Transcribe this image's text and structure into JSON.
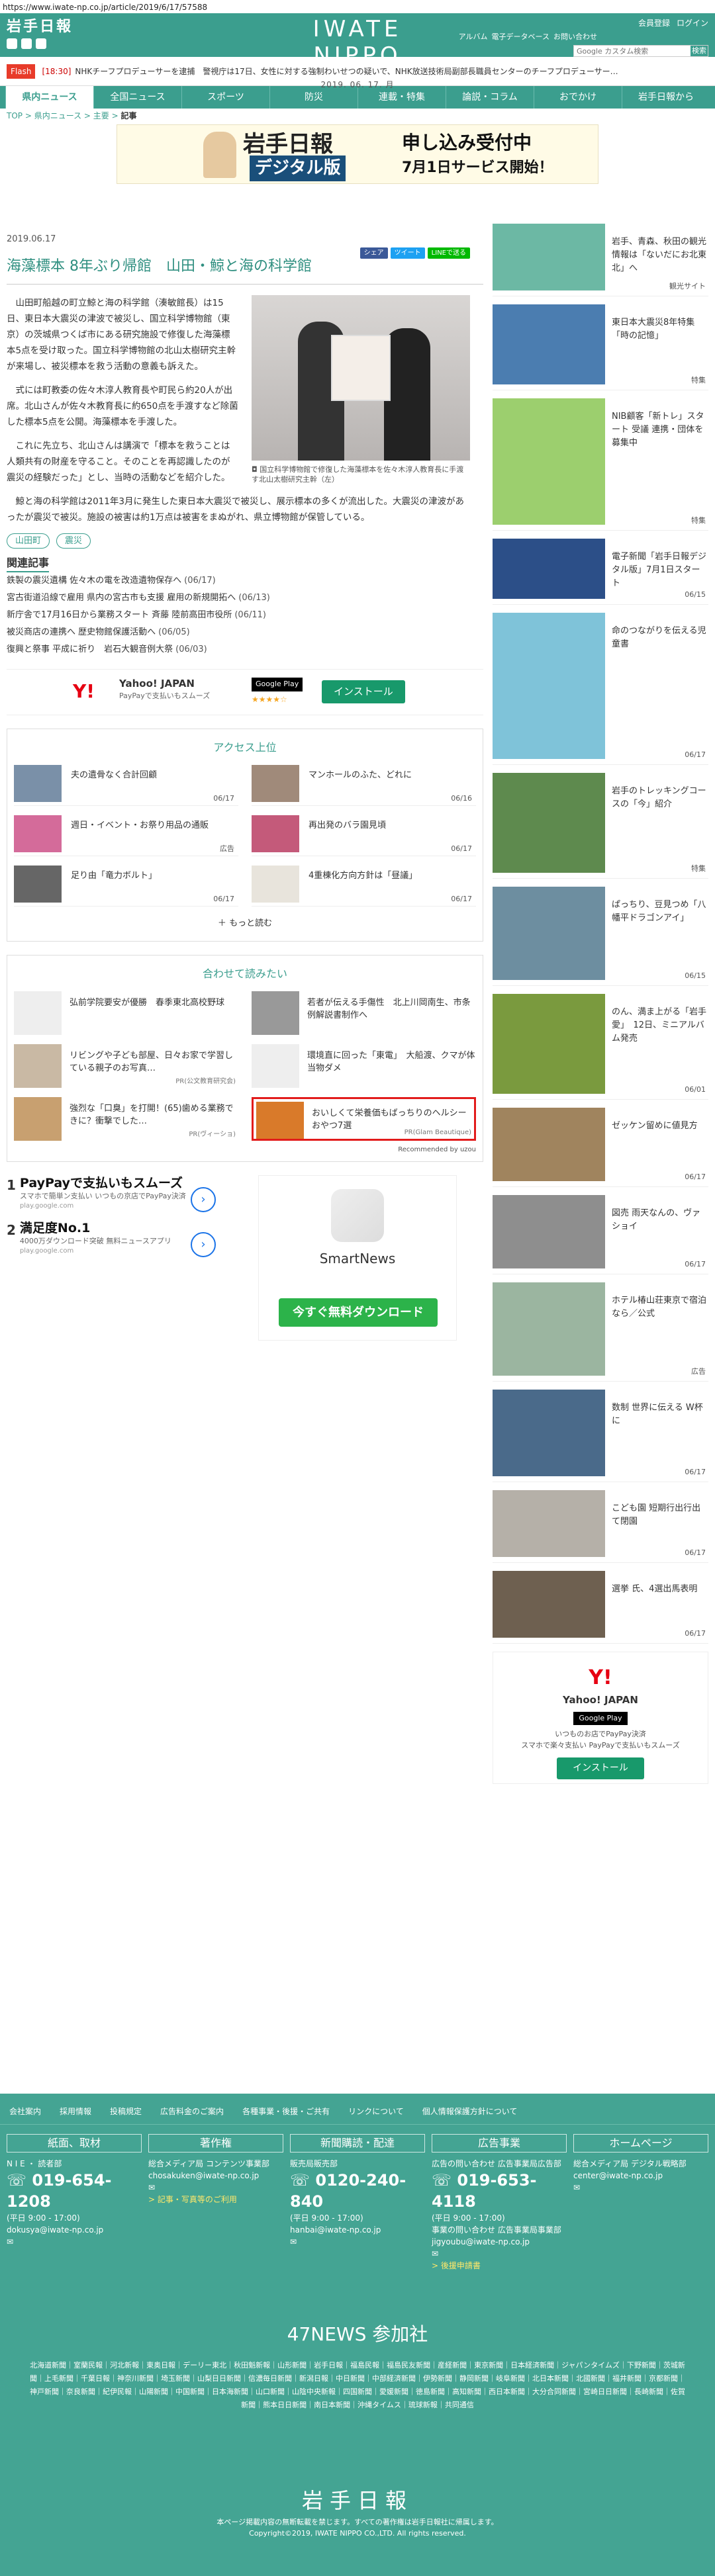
{
  "url": "https://www.iwate-np.co.jp/article/2019/6/17/57588",
  "header": {
    "logo": "岩手日報",
    "brand": "IWATE NIPPO",
    "date": "2019. 06. 17.  月",
    "links": [
      "会員登録",
      "ログイン"
    ],
    "sub": [
      "Web",
      "アルバム",
      "→",
      "電子データベース",
      "→",
      "お問い合わせ"
    ],
    "search_placeholder": "Google カスタム検索",
    "search_btn": "検索"
  },
  "flash": {
    "tag": "Flash",
    "time": "[18:30]",
    "message": "NHKチーフプロデューサーを逮捕　警視庁は17日、女性に対する強制わいせつの疑いで、NHK放送技術局副部長職員センターのチーフプロデューサー…"
  },
  "nav": [
    "県内ニュース",
    "全国ニュース",
    "スポーツ",
    "防災",
    "連載・特集",
    "論説・コラム",
    "おでかけ",
    "岩手日報から"
  ],
  "breadcrumb": [
    "TOP",
    "県内ニュース",
    "主要",
    "記事"
  ],
  "banner": {
    "logo": "岩手日報",
    "sub": "デジタル版",
    "headline": "申し込み受付中",
    "line2": "7月1日サービス開始！"
  },
  "article": {
    "date": "2019.06.17",
    "share": [
      "シェア",
      "ツイート",
      "LINEで送る"
    ],
    "title": "海藻標本 8年ぶり帰館　山田・鯨と海の科学館",
    "p1": "山田町船越の町立鯨と海の科学館（湊敏館長）は15日、東日本大震災の津波で被災し、国立科学博物館（東京）の茨城県つくば市にある研究施設で修復した海藻標本5点を受け取った。国立科学博物館の北山太樹研究主幹が来場し、被災標本を救う活動の意義も訴えた。",
    "p2": "式には町教委の佐々木淳人教育長や町民ら約20人が出席。北山さんが佐々木教育長に約650点を手渡すなど除菌した標本5点を公開。海藻標本を手渡した。",
    "p3": "これに先立ち、北山さんは講演で「標本を救うことは人類共有の財産を守ること。そのことを再認識したのが震災の経験だった」とし、当時の活動などを紹介した。",
    "p4": "鯨と海の科学館は2011年3月に発生した東日本大震災で被災し、展示標本の多くが流出した。大震災の津波があったが震災で被災。施設の被害は約1万点は被害をまぬがれ、県立博物館が保管している。",
    "caption": "国立科学博物館で修復した海藻標本を佐々木淳人教育長に手渡す北山太樹研究主幹（左）",
    "tags": [
      "山田町",
      "震災"
    ]
  },
  "related": {
    "title": "関連記事",
    "items": [
      {
        "t": "鉄製の震災遺構 佐々木の電を改造遺物保存へ",
        "d": "(06/17)"
      },
      {
        "t": "宮古街道沿線で雇用 県内の宮古市も支援 雇用の新規開拓へ",
        "d": "(06/13)"
      },
      {
        "t": "新庁舎で17月16日から業務スタート 斉藤 陸前高田市役所",
        "d": "(06/11)"
      },
      {
        "t": "被災商店の連携へ 歴史物館保護活動へ",
        "d": "(06/05)"
      },
      {
        "t": "復興と祭事 平成に祈り　岩石大観音例大祭",
        "d": "(06/03)"
      }
    ]
  },
  "ad1": {
    "logo": "Y!",
    "title": "Yahoo! JAPAN",
    "sub": "PayPayで支払いもスムーズ",
    "store": "Google Play",
    "rating": "★★★★☆",
    "button": "インストール"
  },
  "ranking": {
    "title": "アクセス上位",
    "items": [
      {
        "t": "夫の遺骨なく合計回顧",
        "d": "06/17"
      },
      {
        "t": "マンホールのふた、どれに",
        "d": "06/16"
      },
      {
        "t": "週日・イベント・お祭り用品の通販",
        "d": "広告"
      },
      {
        "t": "再出発のバラ園見頃",
        "d": "06/17"
      },
      {
        "t": "足り由「竜力ボルト」",
        "d": "06/17"
      },
      {
        "t": "4重棟化方向方針は「昼議」",
        "d": "06/17"
      }
    ],
    "more": "もっと読む"
  },
  "reads": {
    "title": "合わせて読みたい",
    "items": [
      {
        "t": "弘前学院要安が優勝　春季東北高校野球",
        "s": ""
      },
      {
        "t": "若者が伝える手傷性　北上川岡南生、市条例解説書制作へ",
        "s": ""
      },
      {
        "t": "リビングや子ども部屋、日々お家で学習している親子のお写真…",
        "s": "PR(公文教育研究会)"
      },
      {
        "t": "環境直に回った「東電」　大船渡、クマが体当物ダメ",
        "s": ""
      },
      {
        "t": "強烈な「口臭」を打開！(65)歯める業務できに？衝撃でした…",
        "s": "PR(ヴィーショ)"
      },
      {
        "t": "おいしくて栄養価もばっちりのヘルシーおやつ7選",
        "s": "PR(Glam Beautique)"
      }
    ],
    "footer": "Recommended by uzou"
  },
  "ads2": {
    "items": [
      {
        "n": "1",
        "h": "PayPayで支払いもスムーズ",
        "s": "スマホで簡単ン支払い いつもの京店でPayPay決済",
        "u": "play.google.com"
      },
      {
        "n": "2",
        "h": "満足度No.1",
        "s": "4000万ダウンロード突破 無料ニュースアプリ",
        "u": "play.google.com"
      }
    ],
    "app": "SmartNews",
    "button": "今すぐ無料ダウンロード"
  },
  "side": [
    {
      "t": "岩手、青森、秋田の観光情報は「ないだにお北東北」へ",
      "d": "観光サイト"
    },
    {
      "t": "東日本大震災8年特集「時の記憶」",
      "d": "特集"
    },
    {
      "t": "NIB顧客「新トレ」スタート 受議 連携・団体を募集中",
      "d": "特集"
    },
    {
      "t": "電子新聞「岩手日報デジタル版」7月1日スタート",
      "d": "06/15"
    },
    {
      "t": "命のつながりを伝える児童書",
      "d": "06/17"
    },
    {
      "t": "岩手のトレッキングコースの「今」紹介",
      "d": "特集"
    },
    {
      "t": "ぱっちり、豆見つめ「八幡平ドラゴンアイ」",
      "d": "06/15"
    },
    {
      "t": "のん、満ま上がる「岩手愛」　12日、ミニアルバム発売",
      "d": "06/01"
    },
    {
      "t": "ゼッケン留めに値見方",
      "d": "06/17"
    },
    {
      "t": "図売 雨天なんの、ヴァショイ",
      "d": "06/17"
    },
    {
      "t": "ホテル椿山荘東京で宿泊なら／公式",
      "d": "広告"
    },
    {
      "t": "数制 世界に伝える W杯に",
      "d": "06/17"
    },
    {
      "t": "こども園 短期行出行出て閉園",
      "d": "06/17"
    },
    {
      "t": "選挙 氏、4選出馬表明",
      "d": "06/17"
    }
  ],
  "side_ad": {
    "logo": "Y!",
    "title": "Yahoo! JAPAN",
    "store": "Google Play",
    "s1": "いつものお店でPayPay決済",
    "s2": "スマホで楽々支払い PayPayで支払いもスムーズ",
    "button": "インストール"
  },
  "footer": {
    "links": [
      "会社案内",
      "採用情報",
      "投稿規定",
      "広告料金のご案内",
      "各種事業・後援・ご共有",
      "リンクについて",
      "個人情報保護方針について"
    ],
    "cols": [
      {
        "h": "紙面、取材",
        "l1": "N I E ・ 読者部",
        "tel": "019-654-1208",
        "hours": "(平日 9:00 - 17:00)",
        "mail": "dokusya@iwate-np.co.jp"
      },
      {
        "h": "著作権",
        "l1": "総合メディア局 コンテンツ事業部",
        "mail": "chosakuken@iwate-np.co.jp",
        "note": "> 記事・写真等のご利用"
      },
      {
        "h": "新聞購読・配達",
        "l1": "販売局販売部",
        "tel": "0120-240-840",
        "hours": "(平日 9:00 - 17:00)",
        "mail": "hanbai@iwate-np.co.jp"
      },
      {
        "h": "広告事業",
        "l1": "広告の問い合わせ 広告事業局広告部",
        "tel": "019-653-4118",
        "hours": "(平日 9:00 - 17:00)",
        "l2": "事業の問い合わせ 広告事業局事業部",
        "mail": "jigyoubu@iwate-np.co.jp",
        "note": "> 後援申請書"
      },
      {
        "h": "ホームページ",
        "l1": "総合メディア局 デジタル戦略部",
        "mail": "center@iwate-np.co.jp"
      }
    ],
    "n47": "47NEWS 参加社",
    "n47list": "北海道新聞｜室蘭民報｜河北新報｜東奥日報｜デーリー東北｜秋田魁新報｜山形新聞｜岩手日報｜福島民報｜福島民友新聞｜産経新聞｜東京新聞｜日本経済新聞｜ジャパンタイムズ｜下野新聞｜茨城新聞｜上毛新聞｜千葉日報｜神奈川新聞｜埼玉新聞｜山梨日日新聞｜信濃毎日新聞｜新潟日報｜中日新聞｜中部経済新聞｜伊勢新聞｜静岡新聞｜岐阜新聞｜北日本新聞｜北國新聞｜福井新聞｜京都新聞｜神戸新聞｜奈良新聞｜紀伊民報｜山陽新聞｜中国新聞｜日本海新聞｜山口新聞｜山陰中央新報｜四国新聞｜愛媛新聞｜徳島新聞｜高知新聞｜西日本新聞｜大分合同新聞｜宮崎日日新聞｜長崎新聞｜佐賀新聞｜熊本日日新聞｜南日本新聞｜沖縄タイムス｜琉球新報｜共同通信",
    "logo": "岩手日報",
    "copy1": "本ページ掲載内容の無断転載を禁じます。すべての著作権は岩手日報社に帰属します。",
    "copy2": "Copyright©2019, IWATE NIPPO CO.,LTD. All rights reserved."
  },
  "colors": {
    "brand": "#3b9e8e",
    "accent": "#e21b1b"
  }
}
